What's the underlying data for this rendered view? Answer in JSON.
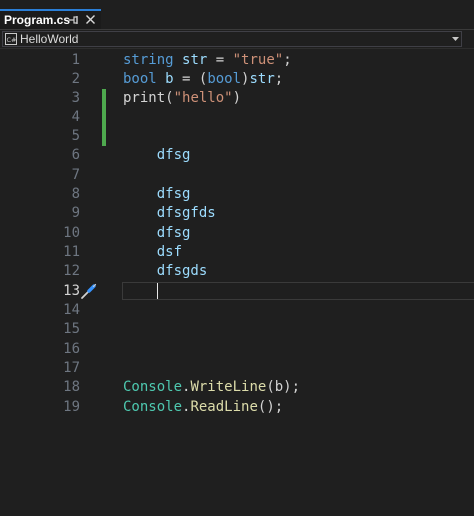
{
  "tab": {
    "title": "Program.cs",
    "pin_glyph": "⊣",
    "close_glyph": "✕",
    "pin_icon": "pin-icon",
    "close_icon": "close-icon"
  },
  "navbar": {
    "project": "HelloWorld",
    "project_icon": "csharp-project-icon",
    "chevron_icon": "chevron-down-icon"
  },
  "editor": {
    "current_line": 13,
    "line_numbers": [
      "1",
      "2",
      "3",
      "4",
      "5",
      "6",
      "7",
      "8",
      "9",
      "10",
      "11",
      "12",
      "13",
      "14",
      "15",
      "16",
      "17",
      "18",
      "19"
    ],
    "quick_action_icon": "screwdriver-icon",
    "colors": {
      "keyword": "#569cd6",
      "identifier": "#9cdcfe",
      "string": "#ce9178",
      "class": "#4ec9b0",
      "method": "#dcdcaa",
      "change_bar": "#4ea94e",
      "background": "#1f1f1f"
    },
    "code": {
      "l1": {
        "kw": "string",
        "sp1": " ",
        "id": "str",
        "rest": " = ",
        "str": "\"true\"",
        "end": ";"
      },
      "l2": {
        "kw1": "bool",
        "sp1": " ",
        "id": "b",
        "mid": " = (",
        "kw2": "bool",
        "close": ")",
        "id2": "str",
        "end": ";"
      },
      "l3": {
        "fn": "print",
        "open": "(",
        "str": "\"hello\"",
        "close": ")"
      },
      "l6": "    dfsg",
      "l8": "    dfsg",
      "l9": "    dfsgfds",
      "l10": "    dfsg",
      "l11": "    dsf",
      "l12": "    dfsgds",
      "l18": {
        "cls": "Console",
        "dot": ".",
        "mth": "WriteLine",
        "args": "(b);"
      },
      "l19": {
        "cls": "Console",
        "dot": ".",
        "mth": "ReadLine",
        "args": "();"
      }
    }
  }
}
